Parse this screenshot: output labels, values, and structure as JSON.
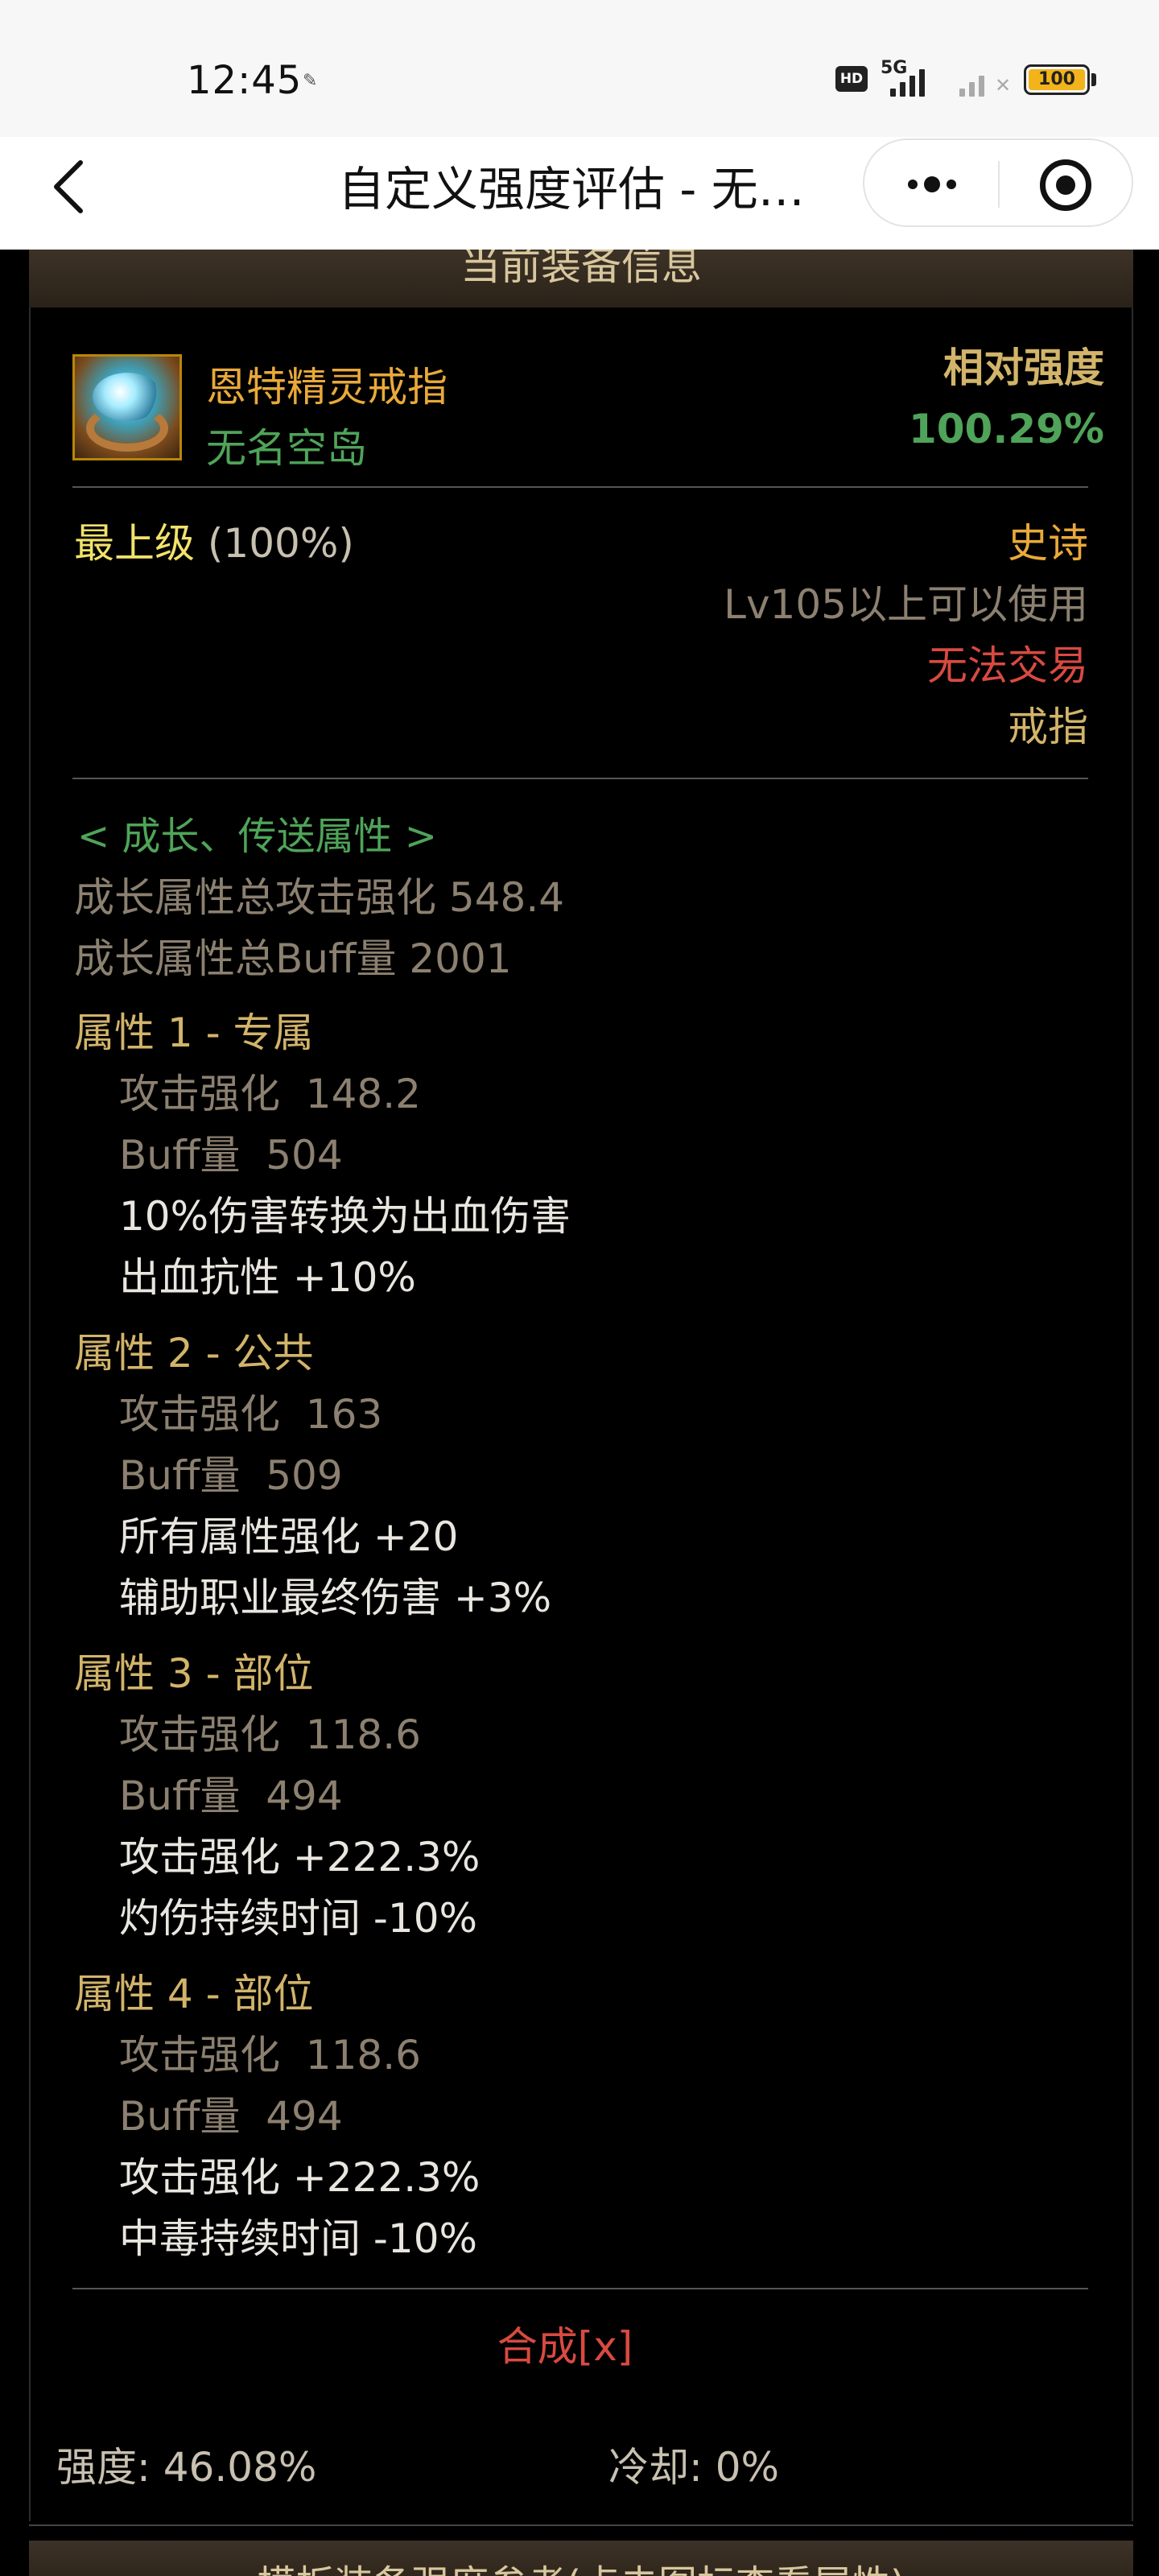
{
  "status_bar": {
    "time": "12:45",
    "network": "5G",
    "hd": "HD",
    "battery": "100"
  },
  "nav": {
    "title": "自定义强度评估 - 无…"
  },
  "panel": {
    "header": "当前装备信息",
    "item": {
      "name": "恩特精灵戒指",
      "subtitle": "无名空岛",
      "strength_label": "相对强度",
      "strength_value": "100.29%"
    },
    "grade": {
      "label": "最上级",
      "percent": "(100%)"
    },
    "meta": {
      "rarity": "史诗",
      "level_req": "Lv105以上可以使用",
      "trade": "无法交易",
      "slot": "戒指"
    },
    "growth": {
      "header": "< 成长、传送属性 >",
      "total_attack": "成长属性总攻击强化 548.4",
      "total_buff": "成长属性总Buff量 2001"
    },
    "attributes": [
      {
        "title": "属性 1 - 专属",
        "attack": "攻击强化  148.2",
        "buff": "Buff量  504",
        "effects": [
          "10%伤害转换为出血伤害",
          "出血抗性 +10%"
        ]
      },
      {
        "title": "属性 2 - 公共",
        "attack": "攻击强化  163",
        "buff": "Buff量  509",
        "effects": [
          "所有属性强化 +20",
          "辅助职业最终伤害 +3%"
        ]
      },
      {
        "title": "属性 3 - 部位",
        "attack": "攻击强化  118.6",
        "buff": "Buff量  494",
        "effects": [
          "攻击强化 +222.3%",
          "灼伤持续时间 -10%"
        ]
      },
      {
        "title": "属性 4 - 部位",
        "attack": "攻击强化  118.6",
        "buff": "Buff量  494",
        "effects": [
          "攻击强化 +222.3%",
          "中毒持续时间 -10%"
        ]
      }
    ],
    "compose_link": "合成[x]"
  },
  "footer": {
    "strength": "强度: 46.08%",
    "cooldown": "冷却: 0%",
    "next_header": "模板装备强度参考(点击图标查看属性)"
  }
}
